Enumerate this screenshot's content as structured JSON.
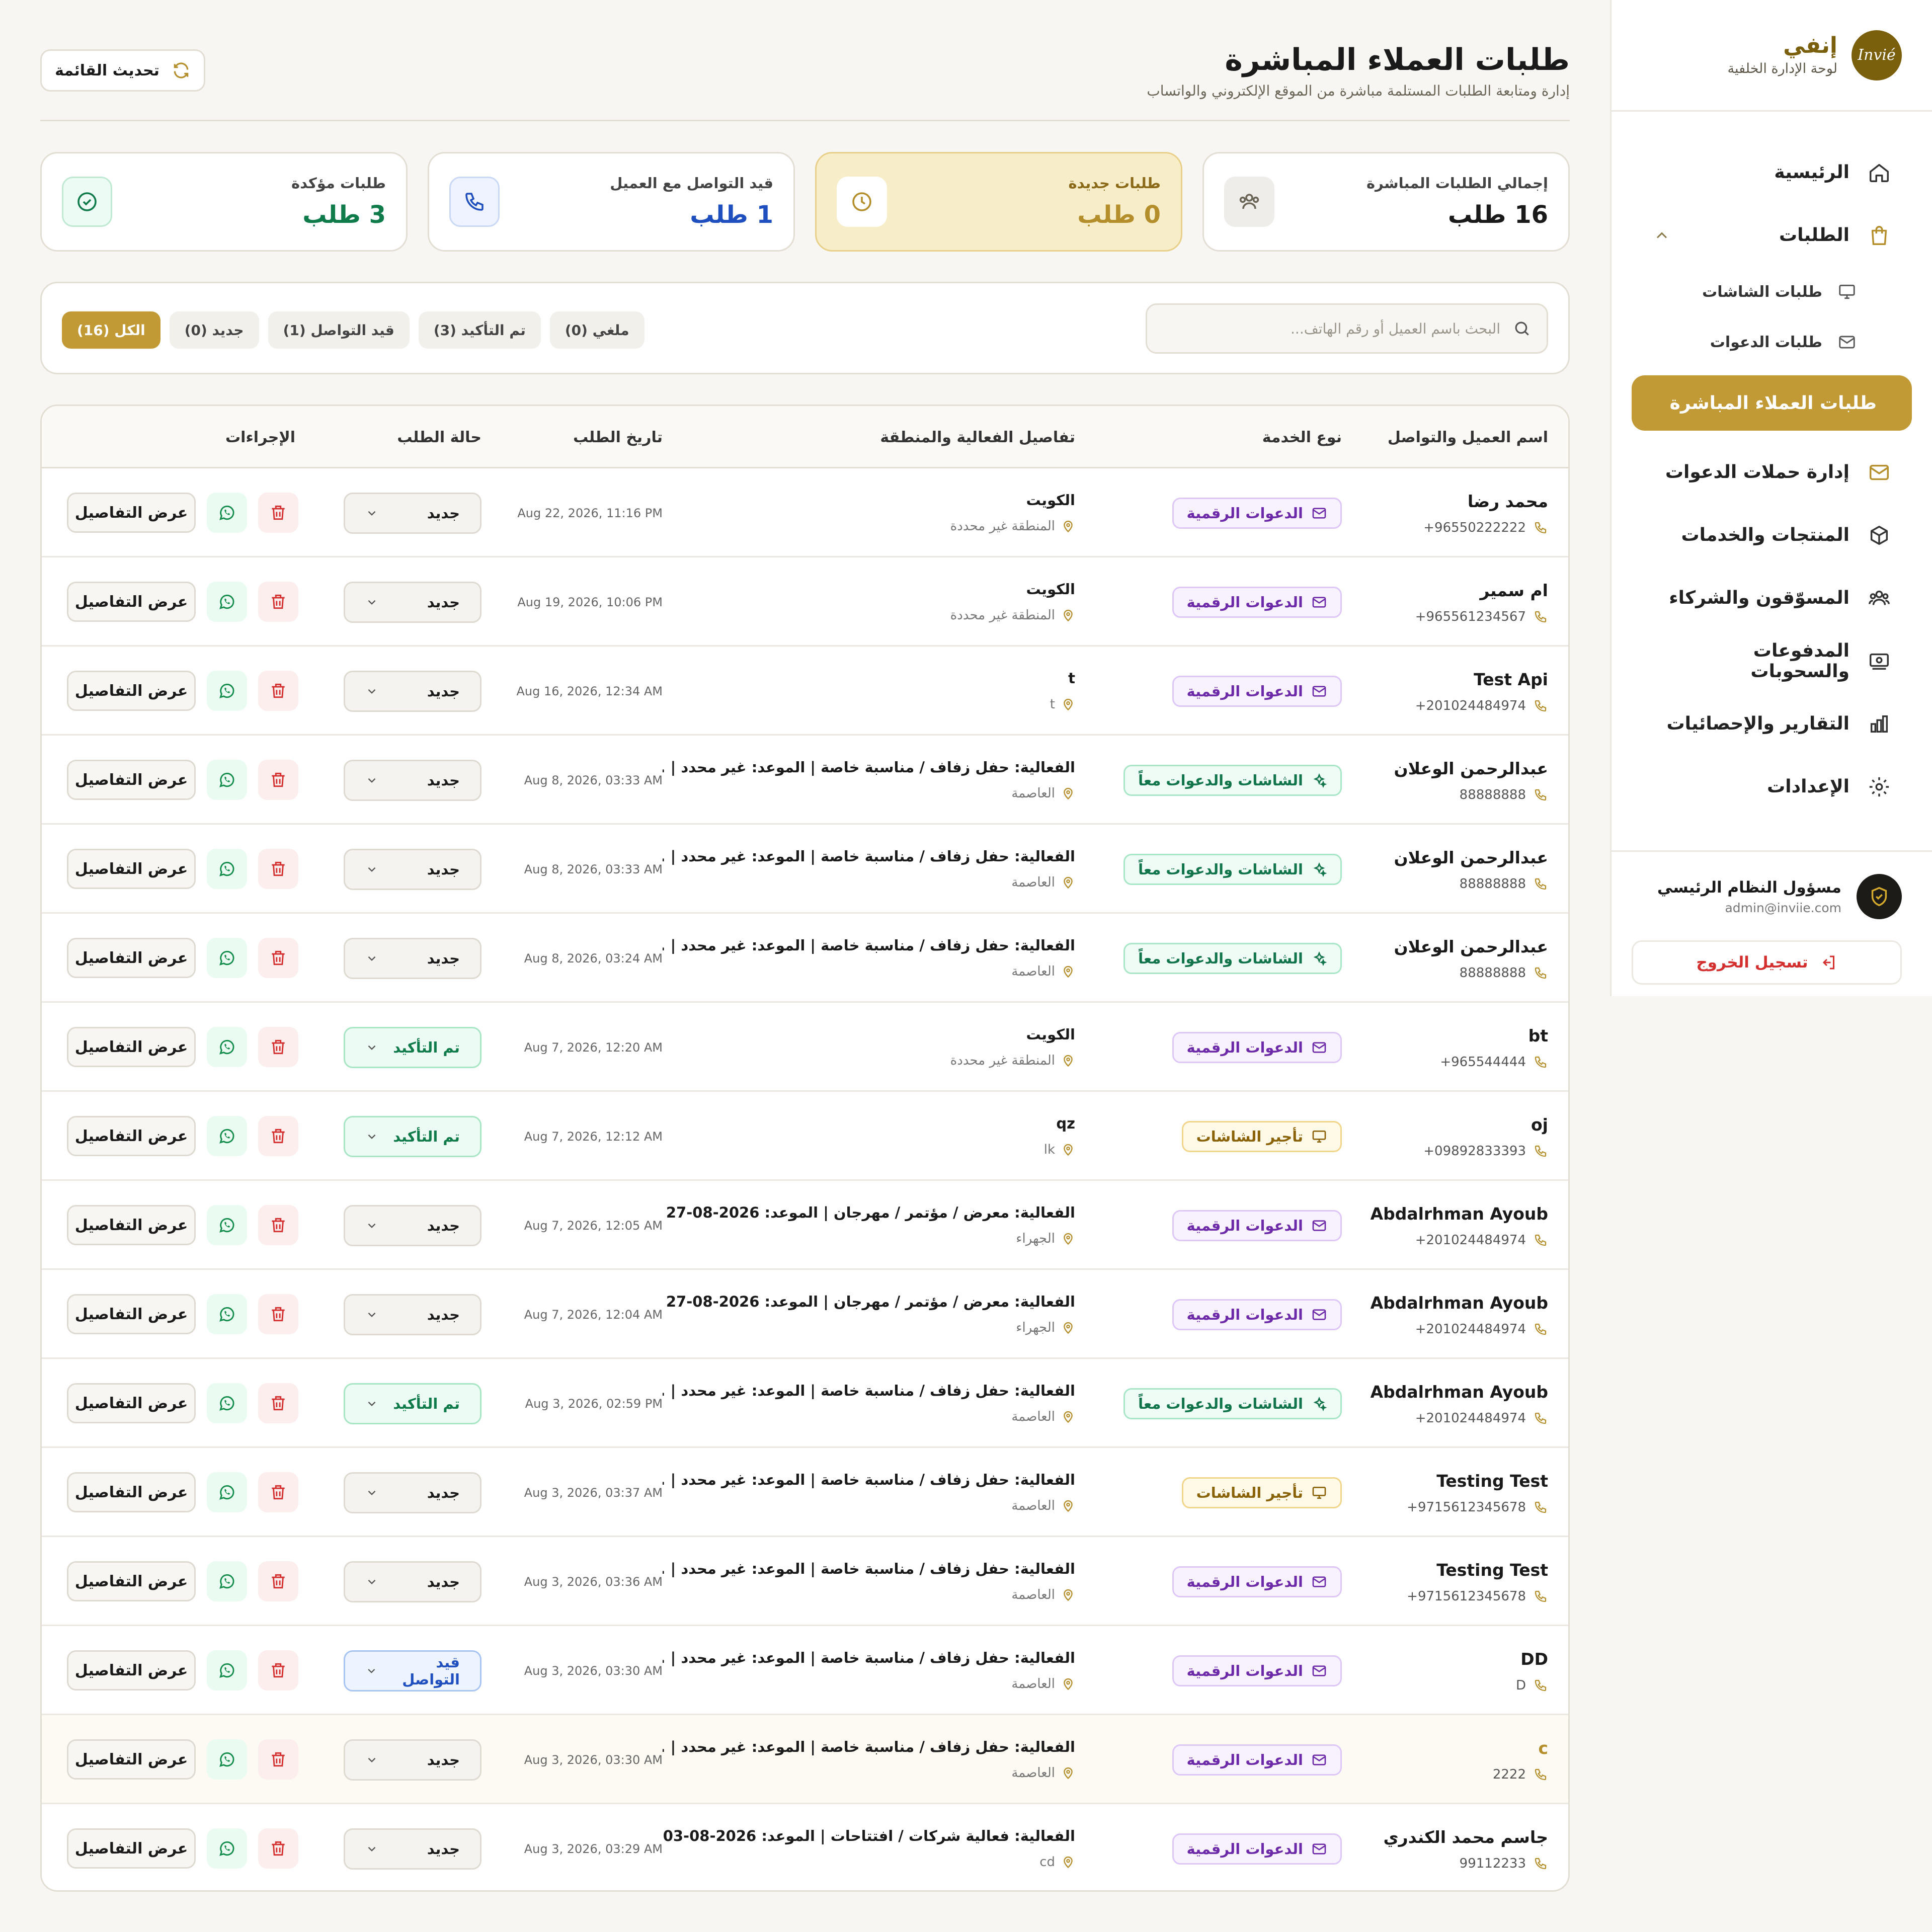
{
  "brand": {
    "name": "إنفي",
    "subtitle": "لوحة الإدارة الخلفية",
    "logo_text": "Invié"
  },
  "sidebar": {
    "items": [
      {
        "label": "الرئيسية",
        "icon": "home-icon"
      },
      {
        "label": "الطلبات",
        "icon": "bag-icon"
      },
      {
        "label": "طلبات الشاشات",
        "icon": "monitor-icon"
      },
      {
        "label": "طلبات الدعوات",
        "icon": "mail-icon"
      },
      {
        "label": "طلبات العملاء المباشرة",
        "icon": ""
      },
      {
        "label": "إدارة حملات الدعوات",
        "icon": "mail-icon"
      },
      {
        "label": "المنتجات والخدمات",
        "icon": "box-icon"
      },
      {
        "label": "المسوّقون والشركاء",
        "icon": "users-icon"
      },
      {
        "label": "المدفوعات والسحوبات",
        "icon": "wallet-icon"
      },
      {
        "label": "التقارير والإحصائيات",
        "icon": "bar-chart-icon"
      },
      {
        "label": "الإعدادات",
        "icon": "gear-icon"
      }
    ],
    "admin_name": "مسؤول النظام الرئيسي",
    "admin_email": "admin@inviie.com",
    "logout_label": "تسجيل الخروج"
  },
  "header": {
    "title": "طلبات العملاء المباشرة",
    "subtitle": "إدارة ومتابعة الطلبات المستلمة مباشرة من الموقع الإلكتروني والواتساب",
    "refresh_label": "تحديث القائمة"
  },
  "stats": [
    {
      "label": "إجمالي الطلبات المباشرة",
      "value": "16 طلب",
      "color": "#1a1a1a",
      "icon": "users-icon"
    },
    {
      "label": "طلبات جديدة",
      "value": "0 طلب",
      "color": "#b38e2a",
      "icon": "clock-icon"
    },
    {
      "label": "قيد التواصل مع العميل",
      "value": "1 طلب",
      "color": "#1f4fbf",
      "icon": "phone-icon"
    },
    {
      "label": "طلبات مؤكدة",
      "value": "3 طلب",
      "color": "#0f7a4a",
      "icon": "check-circle-icon"
    }
  ],
  "search": {
    "placeholder": "البحث باسم العميل أو رقم الهاتف..."
  },
  "filters": [
    "الكل (16)",
    "جديد (0)",
    "قيد التواصل (1)",
    "تم التأكيد (3)",
    "ملغي (0)"
  ],
  "table": {
    "headers": [
      "اسم العميل والتواصل",
      "نوع الخدمة",
      "تفاصيل الفعالية والمنطقة",
      "تاريخ الطلب",
      "حالة الطلب",
      "الإجراءات"
    ],
    "details_label": "عرض التفاصيل",
    "rows": [
      {
        "name": "محمد رضا",
        "phone": "+96550222222",
        "service": "الدعوات الرقمية",
        "stype": "purple",
        "details": "الكويت",
        "region": "المنطقة غير محددة",
        "date": "Aug 22, 2026, 11:16 PM",
        "status": "جديد",
        "st": "new"
      },
      {
        "name": "ام سمير",
        "phone": "+965561234567",
        "service": "الدعوات الرقمية",
        "stype": "purple",
        "details": "الكويت",
        "region": "المنطقة غير محددة",
        "date": "Aug 19, 2026, 10:06 PM",
        "status": "جديد",
        "st": "new"
      },
      {
        "name": "Test Api",
        "phone": "+201024484974",
        "service": "الدعوات الرقمية",
        "stype": "purple",
        "details": "t",
        "region": "t",
        "date": "Aug 16, 2026, 12:34 AM",
        "status": "جديد",
        "st": "new"
      },
      {
        "name": "عبدالرحمن الوعلان",
        "phone": "88888888",
        "service": "الشاشات والدعوات معاً",
        "stype": "green",
        "details": "الفعالية: حفل زفاف / مناسبة خاصة | الموعد: غير محدد | ...",
        "region": "العاصمة",
        "date": "Aug 8, 2026, 03:33 AM",
        "status": "جديد",
        "st": "new"
      },
      {
        "name": "عبدالرحمن الوعلان",
        "phone": "88888888",
        "service": "الشاشات والدعوات معاً",
        "stype": "green",
        "details": "الفعالية: حفل زفاف / مناسبة خاصة | الموعد: غير محدد | ...",
        "region": "العاصمة",
        "date": "Aug 8, 2026, 03:33 AM",
        "status": "جديد",
        "st": "new"
      },
      {
        "name": "عبدالرحمن الوعلان",
        "phone": "88888888",
        "service": "الشاشات والدعوات معاً",
        "stype": "green",
        "details": "الفعالية: حفل زفاف / مناسبة خاصة | الموعد: غير محدد | ...",
        "region": "العاصمة",
        "date": "Aug 8, 2026, 03:24 AM",
        "status": "جديد",
        "st": "new"
      },
      {
        "name": "bt",
        "phone": "+965544444",
        "service": "الدعوات الرقمية",
        "stype": "purple",
        "details": "الكويت",
        "region": "المنطقة غير محددة",
        "date": "Aug 7, 2026, 12:20 AM",
        "status": "تم التأكيد",
        "st": "confirm"
      },
      {
        "name": "oj",
        "phone": "+09892833393",
        "service": "تأجير الشاشات",
        "stype": "yellow",
        "details": "qz",
        "region": "lk",
        "date": "Aug 7, 2026, 12:12 AM",
        "status": "تم التأكيد",
        "st": "confirm"
      },
      {
        "name": "Abdalrhman Ayoub",
        "phone": "+201024484974",
        "service": "الدعوات الرقمية",
        "stype": "purple",
        "details": "الفعالية: معرض / مؤتمر / مهرجان | الموعد: 2026-08-27 | ...",
        "region": "الجهراء",
        "date": "Aug 7, 2026, 12:05 AM",
        "status": "جديد",
        "st": "new"
      },
      {
        "name": "Abdalrhman Ayoub",
        "phone": "+201024484974",
        "service": "الدعوات الرقمية",
        "stype": "purple",
        "details": "الفعالية: معرض / مؤتمر / مهرجان | الموعد: 2026-08-27 | ...",
        "region": "الجهراء",
        "date": "Aug 7, 2026, 12:04 AM",
        "status": "جديد",
        "st": "new"
      },
      {
        "name": "Abdalrhman Ayoub",
        "phone": "+201024484974",
        "service": "الشاشات والدعوات معاً",
        "stype": "green",
        "details": "الفعالية: حفل زفاف / مناسبة خاصة | الموعد: غير محدد | ...",
        "region": "العاصمة",
        "date": "Aug 3, 2026, 02:59 PM",
        "status": "تم التأكيد",
        "st": "confirm"
      },
      {
        "name": "Testing Test",
        "phone": "+9715612345678",
        "service": "تأجير الشاشات",
        "stype": "yellow",
        "details": "الفعالية: حفل زفاف / مناسبة خاصة | الموعد: غير محدد | ...",
        "region": "العاصمة",
        "date": "Aug 3, 2026, 03:37 AM",
        "status": "جديد",
        "st": "new"
      },
      {
        "name": "Testing Test",
        "phone": "+9715612345678",
        "service": "الدعوات الرقمية",
        "stype": "purple",
        "details": "الفعالية: حفل زفاف / مناسبة خاصة | الموعد: غير محدد | ...",
        "region": "العاصمة",
        "date": "Aug 3, 2026, 03:36 AM",
        "status": "جديد",
        "st": "new"
      },
      {
        "name": "DD",
        "phone": "D",
        "service": "الدعوات الرقمية",
        "stype": "purple",
        "details": "الفعالية: حفل زفاف / مناسبة خاصة | الموعد: غير محدد | ...",
        "region": "العاصمة",
        "date": "Aug 3, 2026, 03:30 AM",
        "status": "قيد التواصل",
        "st": "contact"
      },
      {
        "name": "c",
        "phone": "2222",
        "service": "الدعوات الرقمية",
        "stype": "purple",
        "details": "الفعالية: حفل زفاف / مناسبة خاصة | الموعد: غير محدد | ...",
        "region": "العاصمة",
        "date": "Aug 3, 2026, 03:30 AM",
        "status": "جديد",
        "st": "new"
      },
      {
        "name": "جاسم محمد الكندري",
        "phone": "99112233",
        "service": "الدعوات الرقمية",
        "stype": "purple",
        "details": "الفعالية: فعالية شركات / افتتاحات | الموعد: 2026-08-03 | ...",
        "region": "cd",
        "date": "Aug 3, 2026, 03:29 AM",
        "status": "جديد",
        "st": "new"
      }
    ]
  }
}
